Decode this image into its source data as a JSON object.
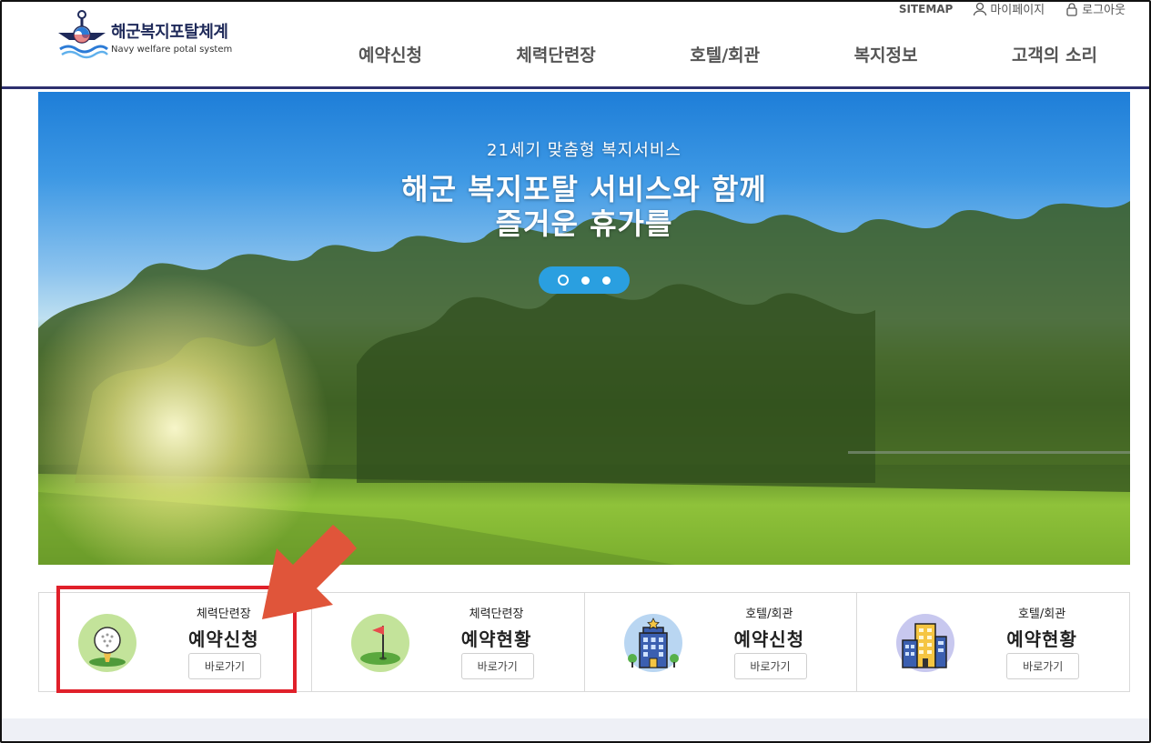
{
  "header": {
    "logo_ko": "해군복지포탈체계",
    "logo_en": "Navy welfare potal system",
    "util": {
      "sitemap": "SITEMAP",
      "mypage": "마이페이지",
      "logout": "로그아웃"
    },
    "nav": [
      "예약신청",
      "체력단련장",
      "호텔/회관",
      "복지정보",
      "고객의 소리"
    ]
  },
  "hero": {
    "subtitle": "21세기 맞춤형 복지서비스",
    "title_line1": "해군 복지포탈 서비스와 함께",
    "title_line2": "즐거운 휴가를",
    "slides": 3,
    "active_slide": 1
  },
  "quick": [
    {
      "category": "체력단련장",
      "name": "예약신청",
      "button": "바로가기",
      "icon": "golf-ball-icon"
    },
    {
      "category": "체력단련장",
      "name": "예약현황",
      "button": "바로가기",
      "icon": "golf-flag-icon"
    },
    {
      "category": "호텔/회관",
      "name": "예약신청",
      "button": "바로가기",
      "icon": "hotel-building-icon"
    },
    {
      "category": "호텔/회관",
      "name": "예약현황",
      "button": "바로가기",
      "icon": "apartment-building-icon"
    }
  ],
  "colors": {
    "accent": "#2d2f6e",
    "highlight": "#e0202a",
    "arrow": "#e0553a",
    "dots": "#2a9fe0"
  }
}
